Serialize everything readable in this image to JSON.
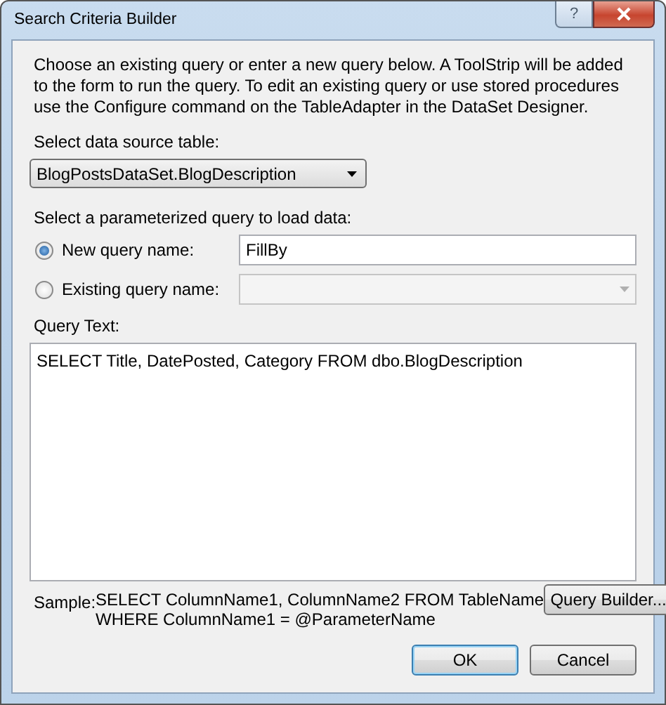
{
  "window": {
    "title": "Search Criteria Builder",
    "help_button": "?"
  },
  "description": "Choose an existing query or enter a new query below. A ToolStrip will be added to the form to run the query. To edit an existing query or use stored procedures use the Configure command on the TableAdapter in the DataSet Designer.",
  "data_source": {
    "label": "Select data source table:",
    "value": "BlogPostsDataSet.BlogDescription"
  },
  "query_choice": {
    "label": "Select a parameterized query to load data:",
    "options": [
      {
        "label": "New query name:",
        "selected": true,
        "kind": "text",
        "value": "FillBy"
      },
      {
        "label": "Existing query name:",
        "selected": false,
        "kind": "dropdown",
        "disabled": true
      }
    ]
  },
  "query_text": {
    "label": "Query Text:",
    "value": "SELECT Title, DatePosted, Category FROM dbo.BlogDescription"
  },
  "sample": {
    "label": "Sample:",
    "lines": [
      "SELECT ColumnName1, ColumnName2 FROM TableName",
      "WHERE ColumnName1 = @ParameterName"
    ]
  },
  "query_builder_button": "Query Builder...",
  "buttons": [
    {
      "label": "OK",
      "default": true
    },
    {
      "label": "Cancel",
      "default": false
    }
  ]
}
